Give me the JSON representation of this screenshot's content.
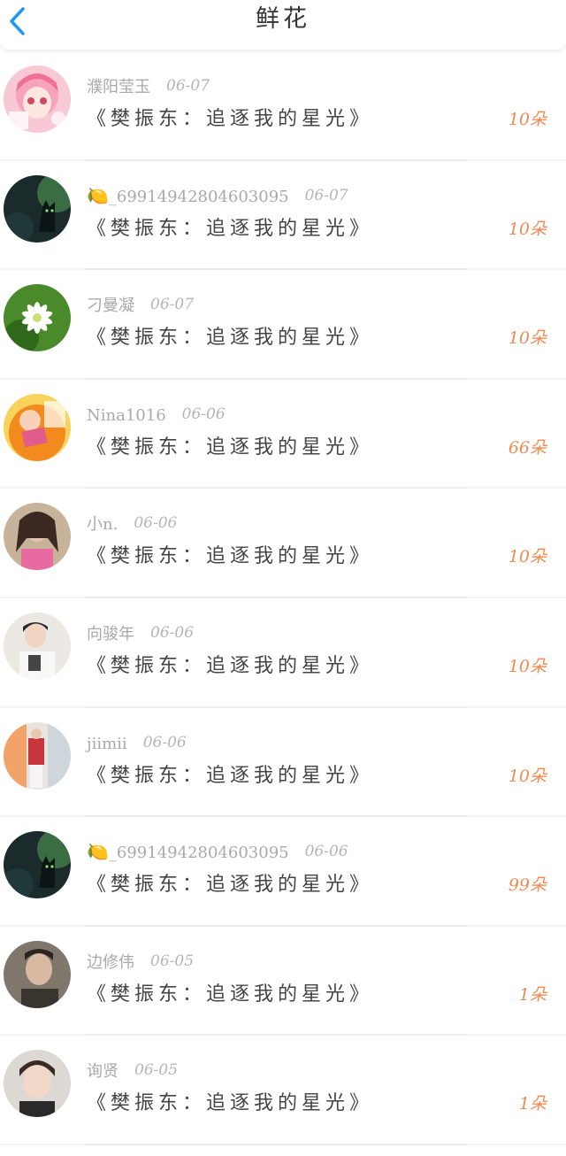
{
  "header": {
    "title": "鲜花"
  },
  "colors": {
    "accent": "#2196F3",
    "amount": "#f08a52"
  },
  "icons": {
    "back": "chevron-left-icon"
  },
  "rows": [
    {
      "user": "濮阳莹玉",
      "emoji": "",
      "date": "06-07",
      "book": "《樊振东：追逐我的星光》",
      "amount": "10朵",
      "avatar": "pink-anime-girl"
    },
    {
      "user": "_6991494280460309​5",
      "emoji": "🍋",
      "date": "06-07",
      "book": "《樊振东：追逐我的星光》",
      "amount": "10朵",
      "avatar": "black-cat"
    },
    {
      "user": "刁曼凝",
      "emoji": "",
      "date": "06-07",
      "book": "《樊振东：追逐我的星光》",
      "amount": "10朵",
      "avatar": "white-flower"
    },
    {
      "user": "Nina1016",
      "emoji": "",
      "date": "06-06",
      "book": "《樊振东：追逐我的星光》",
      "amount": "66朵",
      "avatar": "cartoon-orange"
    },
    {
      "user": "小n.",
      "emoji": "",
      "date": "06-06",
      "book": "《樊振东：追逐我的星光》",
      "amount": "10朵",
      "avatar": "woman-photo"
    },
    {
      "user": "向骏年",
      "emoji": "",
      "date": "06-06",
      "book": "《樊振东：追逐我的星光》",
      "amount": "10朵",
      "avatar": "boy-photo"
    },
    {
      "user": "jiimii",
      "emoji": "",
      "date": "06-06",
      "book": "《樊振东：追逐我的星光》",
      "amount": "10朵",
      "avatar": "street-photo"
    },
    {
      "user": "_6991494280460309​5",
      "emoji": "🍋",
      "date": "06-06",
      "book": "《樊振东：追逐我的星光》",
      "amount": "99朵",
      "avatar": "black-cat"
    },
    {
      "user": "边修伟",
      "emoji": "",
      "date": "06-05",
      "book": "《樊振东：追逐我的星光》",
      "amount": "1朵",
      "avatar": "man-photo"
    },
    {
      "user": "询贤",
      "emoji": "",
      "date": "06-05",
      "book": "《樊振东：追逐我的星光》",
      "amount": "1朵",
      "avatar": "young-man-photo"
    }
  ]
}
